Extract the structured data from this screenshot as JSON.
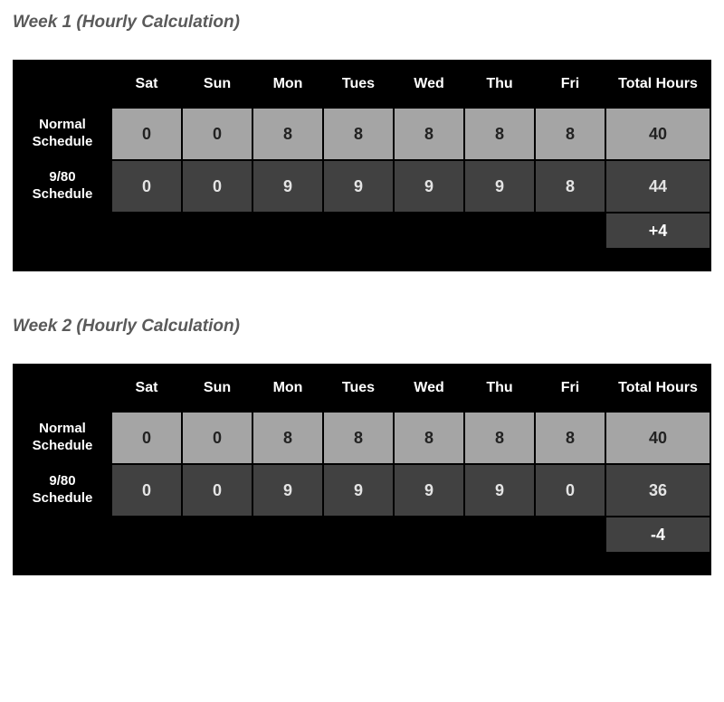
{
  "headers": {
    "blank": "",
    "sat": "Sat",
    "sun": "Sun",
    "mon": "Mon",
    "tue": "Tues",
    "wed": "Wed",
    "thu": "Thu",
    "fri": "Fri",
    "total": "Total Hours"
  },
  "row_labels": {
    "normal": "Normal Schedule",
    "nine80": "9/80 Schedule"
  },
  "week1": {
    "title": "Week 1 (Hourly Calculation)",
    "normal": {
      "sat": "0",
      "sun": "0",
      "mon": "8",
      "tue": "8",
      "wed": "8",
      "thu": "8",
      "fri": "8",
      "total": "40"
    },
    "nine80": {
      "sat": "0",
      "sun": "0",
      "mon": "9",
      "tue": "9",
      "wed": "9",
      "thu": "9",
      "fri": "8",
      "total": "44"
    },
    "delta": "+4"
  },
  "week2": {
    "title": "Week 2 (Hourly Calculation)",
    "normal": {
      "sat": "0",
      "sun": "0",
      "mon": "8",
      "tue": "8",
      "wed": "8",
      "thu": "8",
      "fri": "8",
      "total": "40"
    },
    "nine80": {
      "sat": "0",
      "sun": "0",
      "mon": "9",
      "tue": "9",
      "wed": "9",
      "thu": "9",
      "fri": "0",
      "total": "36"
    },
    "delta": "-4"
  }
}
